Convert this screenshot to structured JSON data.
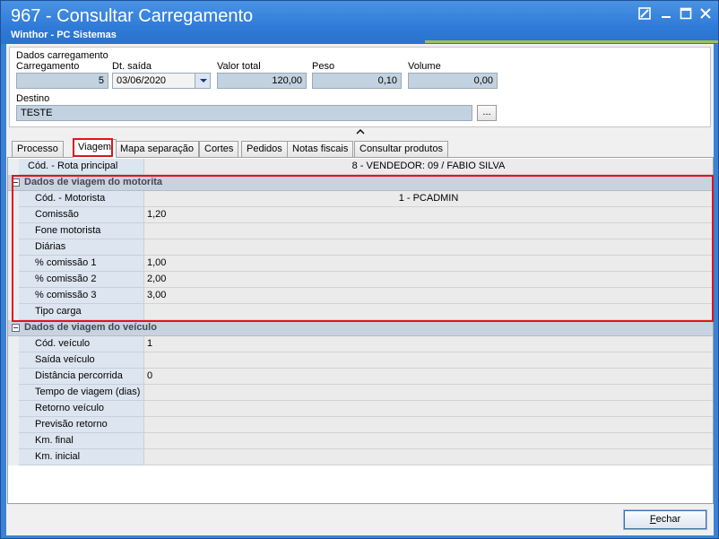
{
  "window": {
    "title": "967 - Consultar Carregamento",
    "subtitle": "Winthor - PC Sistemas",
    "controls": [
      "restore-icon",
      "minimize-icon",
      "maximize-icon",
      "close-icon"
    ]
  },
  "dados_carregamento": {
    "section_label": "Dados carregamento",
    "carregamento": {
      "label": "Carregamento",
      "value": "5"
    },
    "dt_saida": {
      "label": "Dt. saída",
      "value": "03/06/2020"
    },
    "valor_total": {
      "label": "Valor total",
      "value": "120,00"
    },
    "peso": {
      "label": "Peso",
      "value": "0,10"
    },
    "volume": {
      "label": "Volume",
      "value": "0,00"
    },
    "destino": {
      "label": "Destino",
      "value": "TESTE"
    },
    "ellipsis": "..."
  },
  "tabs": [
    {
      "label": "Processo"
    },
    {
      "label": "Viagem",
      "active": true
    },
    {
      "label": "Mapa separação"
    },
    {
      "label": "Cortes"
    },
    {
      "label": "Pedidos"
    },
    {
      "label": "Notas fiscais"
    },
    {
      "label": "Consultar produtos"
    }
  ],
  "grid": {
    "rota": {
      "name": "Cód.  - Rota principal",
      "value": "8 - VENDEDOR: 09 / FABIO SILVA"
    },
    "motorista_group": {
      "title": "Dados de viagem do motorita",
      "rows": [
        {
          "name": "Cód.  - Motorista",
          "value": "1 - PCADMIN",
          "center": true
        },
        {
          "name": "Comissão",
          "value": "1,20"
        },
        {
          "name": "Fone motorista",
          "value": ""
        },
        {
          "name": "Diárias",
          "value": ""
        },
        {
          "name": "% comissão 1",
          "value": "1,00"
        },
        {
          "name": "% comissão 2",
          "value": "2,00"
        },
        {
          "name": "% comissão 3",
          "value": "3,00"
        },
        {
          "name": "Tipo carga",
          "value": ""
        }
      ]
    },
    "veiculo_group": {
      "title": "Dados de viagem do veículo",
      "rows": [
        {
          "name": "Cód. veículo",
          "value": "1"
        },
        {
          "name": "Saída veículo",
          "value": ""
        },
        {
          "name": "Distância percorrida",
          "value": "0"
        },
        {
          "name": "Tempo de viagem (dias)",
          "value": ""
        },
        {
          "name": "Retorno veículo",
          "value": ""
        },
        {
          "name": "Previsão retorno",
          "value": ""
        },
        {
          "name": "Km. final",
          "value": ""
        },
        {
          "name": "Km. inicial",
          "value": ""
        }
      ]
    }
  },
  "footer": {
    "close_label": "Fechar"
  },
  "highlight_color": "#e0141c"
}
